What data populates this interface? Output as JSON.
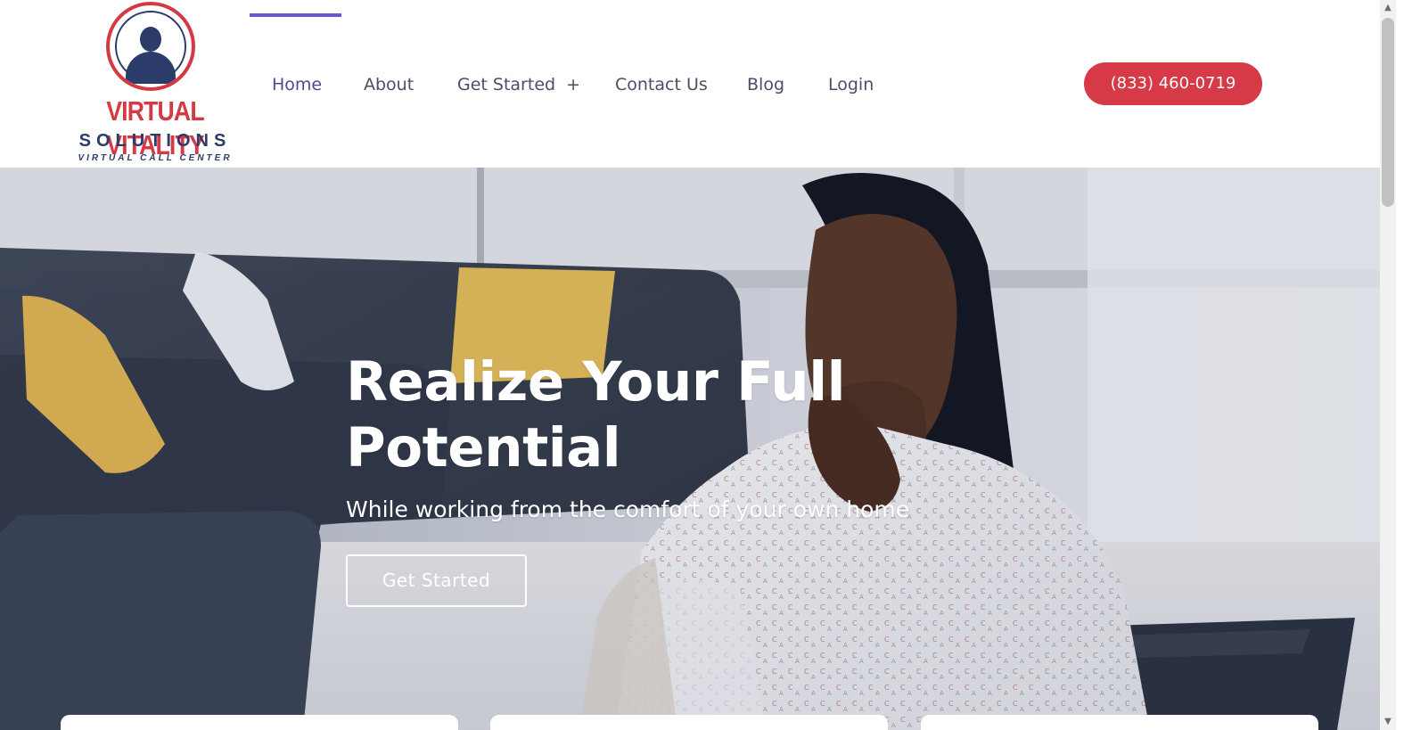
{
  "brand": {
    "logo_line_1": "VIRTUAL VITALITY",
    "logo_line_2": "SOLUTIONS",
    "logo_line_3": "VIRTUAL CALL CENTER",
    "logo_icon": "headset-agent-icon"
  },
  "nav": {
    "items": [
      {
        "label": "Home",
        "active": true
      },
      {
        "label": "About"
      },
      {
        "label": "Get Started",
        "submenu_indicator": "+"
      },
      {
        "label": "Contact Us"
      },
      {
        "label": "Blog"
      },
      {
        "label": "Login"
      }
    ]
  },
  "header": {
    "phone_label": "(833) 460-0719"
  },
  "hero": {
    "title_line_1": "Realize Your Full",
    "title_line_2": "Potential",
    "subtitle": "While working from the comfort of your own home",
    "button_label": "Get Started"
  },
  "colors": {
    "accent_purple": "#6a55d8",
    "phone_red": "#d63a46",
    "logo_red": "#d33a44",
    "logo_navy": "#2b3b6a",
    "nav_text": "#4b4f66",
    "active_nav_text": "#4b4a94"
  },
  "scrollbar": {
    "up_icon": "triangle-up-icon",
    "down_icon": "triangle-down-icon"
  }
}
